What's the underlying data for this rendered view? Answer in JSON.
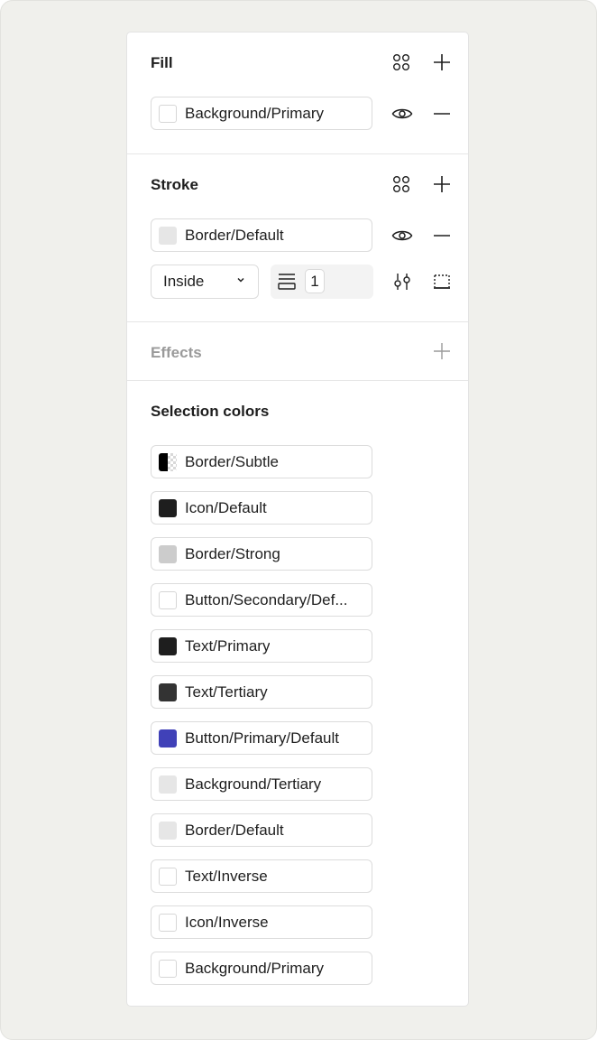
{
  "fill": {
    "title": "Fill",
    "style_name": "Background/Primary",
    "swatch_color": "#ffffff",
    "icons": [
      "styles-icon",
      "plus-icon",
      "eye-icon",
      "minus-icon"
    ]
  },
  "stroke": {
    "title": "Stroke",
    "style_name": "Border/Default",
    "swatch_color": "#e6e6e6",
    "position": "Inside",
    "weight": "1",
    "icons": [
      "styles-icon",
      "plus-icon",
      "eye-icon",
      "minus-icon",
      "stroke-settings-icon",
      "stroke-sides-icon",
      "stroke-weight-icon",
      "chevron-down-icon"
    ]
  },
  "effects": {
    "title": "Effects",
    "icons": [
      "plus-icon"
    ]
  },
  "selection_colors": {
    "title": "Selection colors",
    "items": [
      {
        "label": "Border/Subtle",
        "color": "#000000",
        "type": "half-checker"
      },
      {
        "label": "Icon/Default",
        "color": "#1e1e1e",
        "type": "solid"
      },
      {
        "label": "Border/Strong",
        "color": "#cccccc",
        "type": "solid"
      },
      {
        "label": "Button/Secondary/Def...",
        "color": "#ffffff",
        "type": "outlined"
      },
      {
        "label": "Text/Primary",
        "color": "#1e1e1e",
        "type": "solid"
      },
      {
        "label": "Text/Tertiary",
        "color": "#333333",
        "type": "solid"
      },
      {
        "label": "Button/Primary/Default",
        "color": "#4041b8",
        "type": "solid"
      },
      {
        "label": "Background/Tertiary",
        "color": "#e6e6e6",
        "type": "solid"
      },
      {
        "label": "Border/Default",
        "color": "#e6e6e6",
        "type": "solid"
      },
      {
        "label": "Text/Inverse",
        "color": "#ffffff",
        "type": "outlined"
      },
      {
        "label": "Icon/Inverse",
        "color": "#ffffff",
        "type": "outlined"
      },
      {
        "label": "Background/Primary",
        "color": "#ffffff",
        "type": "outlined"
      }
    ]
  },
  "colors": {
    "frame_bg": "#f0f0ec",
    "panel_bg": "#ffffff",
    "text": "#1e1e1e",
    "muted": "#9a9a9a"
  }
}
